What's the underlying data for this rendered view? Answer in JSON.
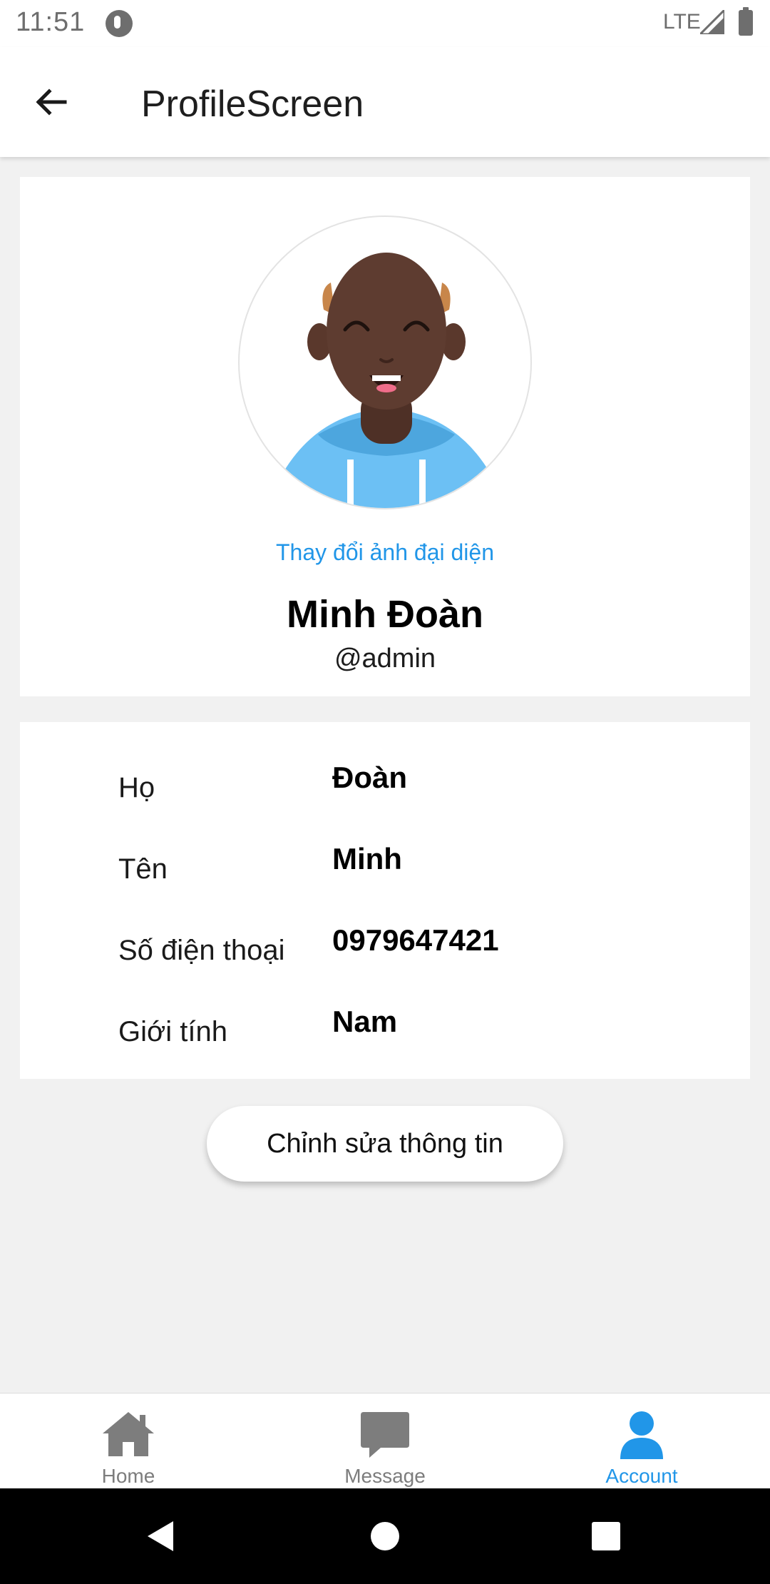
{
  "status_bar": {
    "time": "11:51",
    "network": "LTE"
  },
  "app_bar": {
    "title": "ProfileScreen"
  },
  "profile": {
    "change_avatar_label": "Thay đổi ảnh đại diện",
    "full_name": "Minh Đoàn",
    "username": "@admin"
  },
  "info": {
    "rows": [
      {
        "label": "Họ",
        "value": "Đoàn"
      },
      {
        "label": "Tên",
        "value": "Minh"
      },
      {
        "label": "Số điện thoại",
        "value": "0979647421"
      },
      {
        "label": "Giới tính",
        "value": "Nam"
      }
    ]
  },
  "edit_button": {
    "label": "Chỉnh sửa thông tin"
  },
  "bottom_nav": {
    "items": [
      {
        "label": "Home",
        "icon": "home-icon",
        "active": false
      },
      {
        "label": "Message",
        "icon": "message-icon",
        "active": false
      },
      {
        "label": "Account",
        "icon": "account-icon",
        "active": true
      }
    ]
  },
  "colors": {
    "accent": "#2196e8",
    "inactive_nav": "#7d7d7d",
    "background": "#f1f1f1"
  }
}
